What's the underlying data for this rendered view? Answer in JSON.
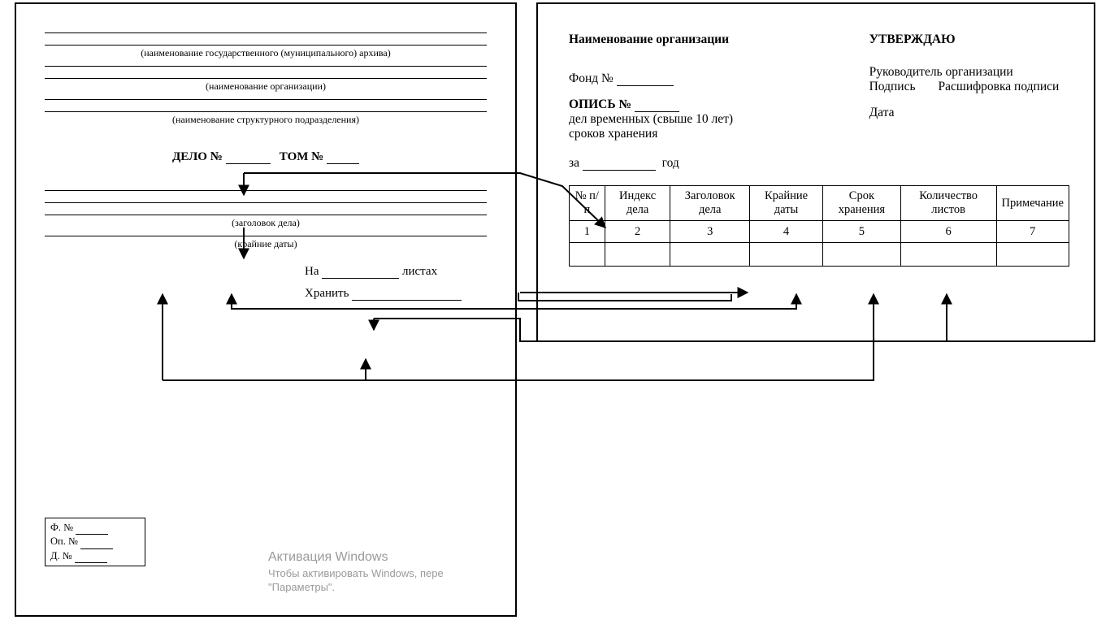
{
  "left": {
    "archive_caption": "(наименование государственного (муниципального) архива)",
    "org_caption": "(наименование организации)",
    "subdiv_caption": "(наименование структурного подразделения)",
    "case_label": "ДЕЛО №",
    "volume_label": "ТОМ №",
    "title_caption": "(заголовок дела)",
    "dates_caption": "(крайние даты)",
    "sheets_prefix": "На",
    "sheets_suffix": "листах",
    "store_label": "Хранить",
    "archbox": {
      "f": "Ф.  №",
      "op": "Оп. №",
      "d": "Д. №"
    }
  },
  "right": {
    "org_label": "Наименование организации",
    "approve": "УТВЕРЖДАЮ",
    "head": "Руководитель организации",
    "sign": "Подпись",
    "sign_decode": "Расшифровка подписи",
    "date": "Дата",
    "fund": "Фонд №",
    "opis": "ОПИСЬ №",
    "opis_sub1": "дел временных (свыше 10 лет)",
    "opis_sub2": "сроков хранения",
    "year_prefix": "за",
    "year_suffix": "год",
    "table": {
      "headers": [
        "№ п/п",
        "Индекс дела",
        "Заголовок дела",
        "Крайние даты",
        "Срок хранения",
        "Количество листов",
        "Примечание"
      ],
      "nums": [
        "1",
        "2",
        "3",
        "4",
        "5",
        "6",
        "7"
      ]
    }
  },
  "watermark": {
    "title": "Активация Windows",
    "sub1": "Чтобы активировать Windows, пере",
    "sub2": "\"Параметры\"."
  }
}
